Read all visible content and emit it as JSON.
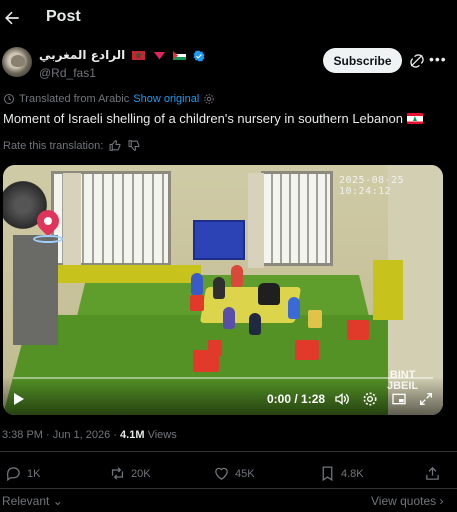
{
  "header": {
    "title": "Post"
  },
  "author": {
    "display_name": "الرادع المغربي",
    "handle": "@Rd_fas1",
    "subscribe_label": "Subscribe"
  },
  "translation": {
    "translated_from": "Translated from Arabic",
    "show_original": "Show original",
    "rate_label": "Rate this translation:"
  },
  "tweet": {
    "text": "Moment of Israeli shelling of a children's nursery in southern Lebanon"
  },
  "video": {
    "camera_timestamp": "2025-08-25 10:24:12",
    "watermark_line1": "BINT",
    "watermark_line2": "JBEIL",
    "time_display": "0:00 / 1:28",
    "progress": 0
  },
  "meta": {
    "time": "3:38 PM",
    "date": "Jun 1, 2026",
    "views_count": "4.1M",
    "views_label": "Views"
  },
  "actions": {
    "replies": "1K",
    "reposts": "20K",
    "likes": "45K",
    "bookmarks": "4.8K"
  },
  "footer": {
    "sort_label": "Relevant",
    "view_quotes": "View quotes"
  },
  "colors": {
    "background": "#000000",
    "text": "#e7e9ea",
    "muted": "#71767b",
    "link": "#1d9bf0",
    "verified": "#1d9bf0"
  }
}
